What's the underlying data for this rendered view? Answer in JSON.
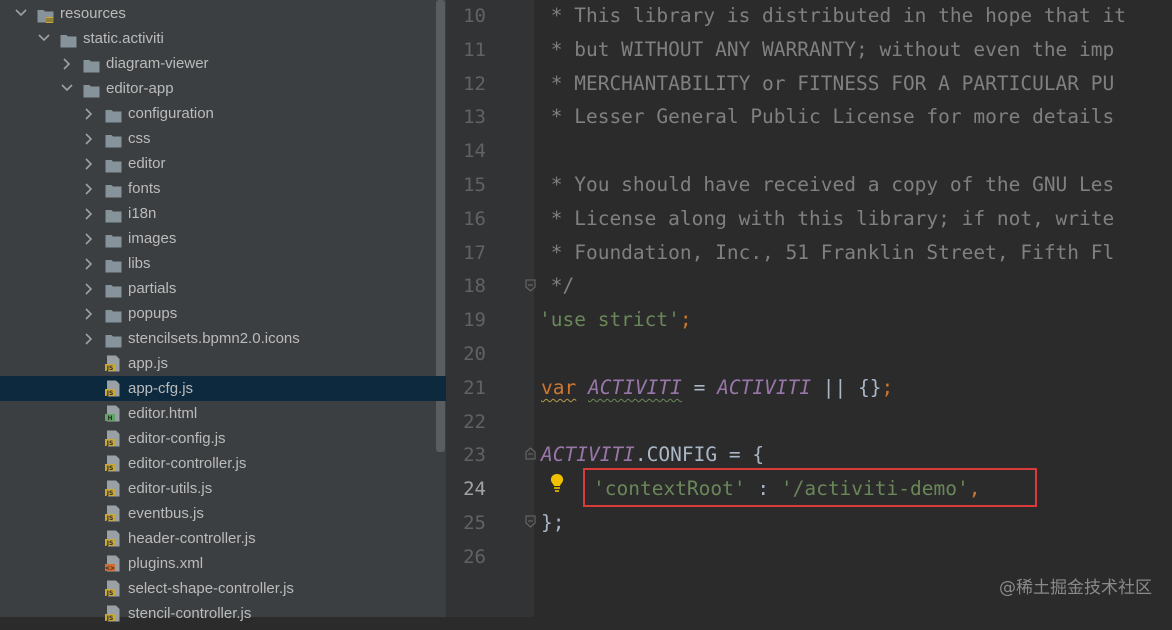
{
  "project_tree": {
    "items": [
      {
        "label": "resources",
        "type": "folder",
        "expanded": true
      },
      {
        "label": "static.activiti",
        "type": "folder",
        "expanded": true
      },
      {
        "label": "diagram-viewer",
        "type": "folder",
        "expanded": false
      },
      {
        "label": "editor-app",
        "type": "folder",
        "expanded": true
      },
      {
        "label": "configuration",
        "type": "folder",
        "expanded": false
      },
      {
        "label": "css",
        "type": "folder",
        "expanded": false
      },
      {
        "label": "editor",
        "type": "folder",
        "expanded": false
      },
      {
        "label": "fonts",
        "type": "folder",
        "expanded": false
      },
      {
        "label": "i18n",
        "type": "folder",
        "expanded": false
      },
      {
        "label": "images",
        "type": "folder",
        "expanded": false
      },
      {
        "label": "libs",
        "type": "folder",
        "expanded": false
      },
      {
        "label": "partials",
        "type": "folder",
        "expanded": false
      },
      {
        "label": "popups",
        "type": "folder",
        "expanded": false
      },
      {
        "label": "stencilsets.bpmn2.0.icons",
        "type": "folder",
        "expanded": false
      },
      {
        "label": "app.js",
        "type": "js"
      },
      {
        "label": "app-cfg.js",
        "type": "js",
        "selected": true
      },
      {
        "label": "editor.html",
        "type": "html"
      },
      {
        "label": "editor-config.js",
        "type": "js"
      },
      {
        "label": "editor-controller.js",
        "type": "js"
      },
      {
        "label": "editor-utils.js",
        "type": "js"
      },
      {
        "label": "eventbus.js",
        "type": "js"
      },
      {
        "label": "header-controller.js",
        "type": "js"
      },
      {
        "label": "plugins.xml",
        "type": "xml"
      },
      {
        "label": "select-shape-controller.js",
        "type": "js"
      },
      {
        "label": "stencil-controller.js",
        "type": "js"
      }
    ]
  },
  "editor": {
    "line_numbers": [
      "10",
      "11",
      "12",
      "13",
      "14",
      "15",
      "16",
      "17",
      "18",
      "19",
      "20",
      "21",
      "22",
      "23",
      "24",
      "25",
      "26"
    ],
    "current_line": "24",
    "comment_lines": [
      " * This library is distributed in the hope that it",
      " * but WITHOUT ANY WARRANTY; without even the imp",
      " * MERCHANTABILITY or FITNESS FOR A PARTICULAR PU",
      " * Lesser General Public License for more details",
      "",
      " * You should have received a copy of the GNU Les",
      " * License along with this library; if not, write",
      " * Foundation, Inc., 51 Franklin Street, Fifth Fl",
      " */"
    ],
    "use_strict": "'use strict'",
    "semicolon": ";",
    "var_kw": "var",
    "activiti": "ACTIVITI",
    "eq": " = ",
    "or_default": " || {}",
    "config_prop": ".CONFIG",
    "open_brace": " = {",
    "key": "'contextRoot'",
    "colon": " : ",
    "value": "'/activiti-demo'",
    "comma": ",",
    "close": "};"
  },
  "colors": {
    "comment": "#808080",
    "string": "#6a8759",
    "keyword": "#cc7832",
    "global": "#9876aa",
    "highlight_box": "#d93a3a",
    "selection": "#0d293e"
  },
  "watermark": "@稀土掘金技术社区"
}
